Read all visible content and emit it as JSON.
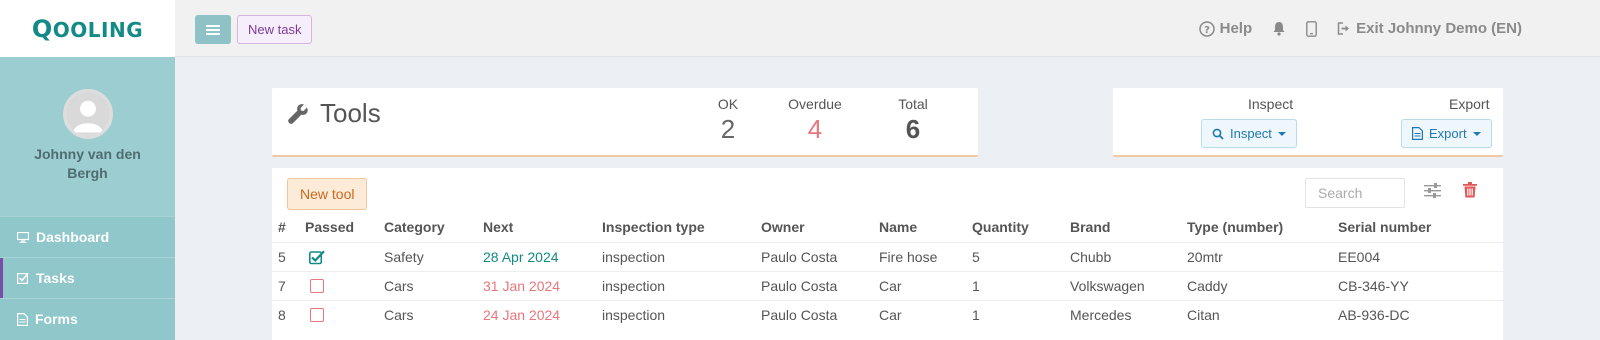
{
  "app": {
    "logo": "Qooling"
  },
  "colors": {
    "accent": "#138a86",
    "sidebar": "#8fc7cb",
    "overdue": "#e8777b",
    "new_task": "#7a3c9a",
    "new_tool": "#c8691e"
  },
  "user": {
    "name": "Johnny van den Bergh"
  },
  "sidebar": {
    "items": [
      {
        "label": "Dashboard",
        "icon": "monitor-icon"
      },
      {
        "label": "Tasks",
        "icon": "checkbox-icon"
      },
      {
        "label": "Forms",
        "icon": "document-icon"
      }
    ]
  },
  "topbar": {
    "new_task_label": "New task",
    "help_label": "Help",
    "exit_label": "Exit Johnny Demo (EN)"
  },
  "tools": {
    "title": "Tools",
    "stats": {
      "ok_label": "OK",
      "ok_value": "2",
      "overdue_label": "Overdue",
      "overdue_value": "4",
      "total_label": "Total",
      "total_value": "6"
    }
  },
  "actions": {
    "inspect_header": "Inspect",
    "inspect_button": "Inspect",
    "export_header": "Export",
    "export_button": "Export"
  },
  "panel": {
    "new_tool_label": "New tool",
    "search_placeholder": "Search"
  },
  "table": {
    "headers": [
      "#",
      "Passed",
      "Category",
      "Next",
      "Inspection type",
      "Owner",
      "Name",
      "Quantity",
      "Brand",
      "Type (number)",
      "Serial number"
    ],
    "rows": [
      {
        "id": "5",
        "passed": true,
        "category": "Safety",
        "next": "28 Apr 2024",
        "next_status": "ok",
        "inspection_type": "inspection",
        "owner": "Paulo Costa",
        "name": "Fire hose",
        "quantity": "5",
        "brand": "Chubb",
        "type": "20mtr",
        "serial": "EE004"
      },
      {
        "id": "7",
        "passed": false,
        "category": "Cars",
        "next": "31 Jan 2024",
        "next_status": "overdue",
        "inspection_type": "inspection",
        "owner": "Paulo Costa",
        "name": "Car",
        "quantity": "1",
        "brand": "Volkswagen",
        "type": "Caddy",
        "serial": "CB-346-YY"
      },
      {
        "id": "8",
        "passed": false,
        "category": "Cars",
        "next": "24 Jan 2024",
        "next_status": "overdue",
        "inspection_type": "inspection",
        "owner": "Paulo Costa",
        "name": "Car",
        "quantity": "1",
        "brand": "Mercedes",
        "type": "Citan",
        "serial": "AB-936-DC"
      }
    ]
  }
}
